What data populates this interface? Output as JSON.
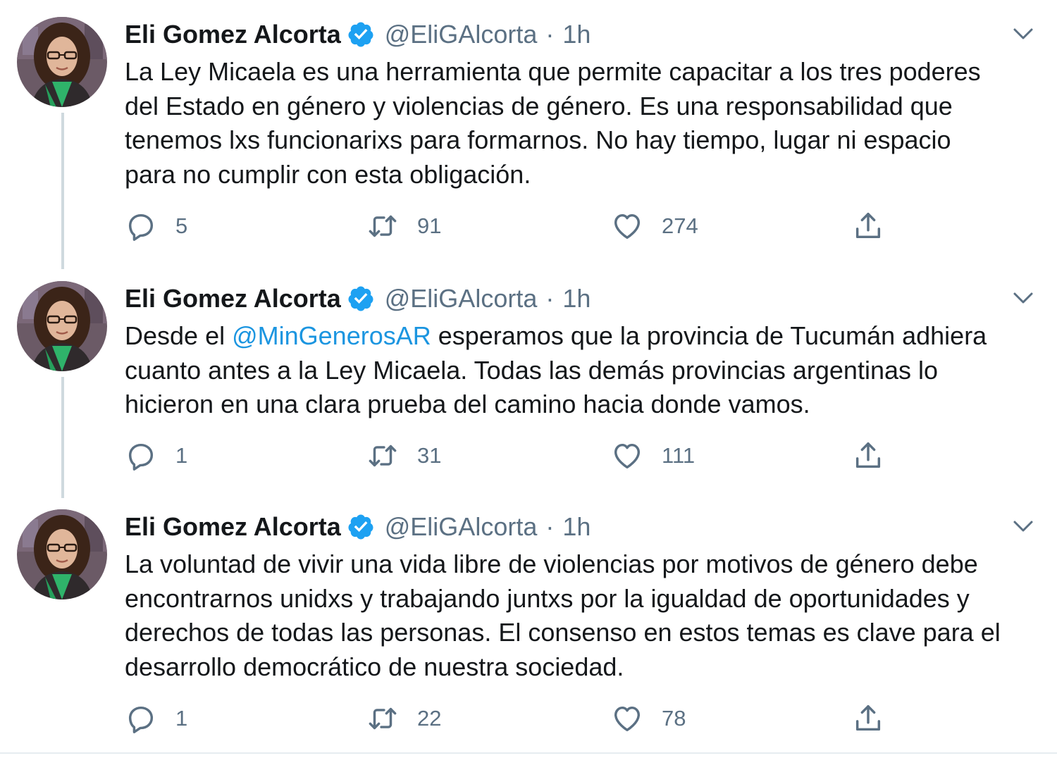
{
  "colors": {
    "text": "#14171a",
    "secondary": "#5b7083",
    "mention": "#1b95e0",
    "verified": "#1da1f2",
    "thread_line": "#cfd9de"
  },
  "tweets": [
    {
      "author_name": "Eli Gomez Alcorta",
      "handle": "@EliGAlcorta",
      "separator": "·",
      "time": "1h",
      "verified_icon": "verified-badge-icon",
      "text_lines": [
        "La Ley Micaela es una herramienta que permite capacitar a los tres poderes",
        "del Estado en género y violencias de género. Es una responsabilidad que",
        "tenemos lxs funcionarixs para formarnos. No hay tiempo, lugar ni espacio",
        "para no cumplir con esta obligación."
      ],
      "replies": "5",
      "retweets": "91",
      "likes": "274"
    },
    {
      "author_name": "Eli Gomez Alcorta",
      "handle": "@EliGAlcorta",
      "separator": "·",
      "time": "1h",
      "verified_icon": "verified-badge-icon",
      "text_line1_before": "Desde el ",
      "text_line1_mention": "@MinGenerosAR",
      "text_line1_after": " esperamos que la provincia de Tucumán adhiera",
      "text_lines": [
        "cuanto antes a la Ley Micaela. Todas las demás provincias argentinas lo",
        "hicieron en una clara prueba del camino hacia donde vamos."
      ],
      "replies": "1",
      "retweets": "31",
      "likes": "111"
    },
    {
      "author_name": "Eli Gomez Alcorta",
      "handle": "@EliGAlcorta",
      "separator": "·",
      "time": "1h",
      "verified_icon": "verified-badge-icon",
      "text_lines": [
        "La voluntad de vivir una vida libre de violencias por motivos de género debe",
        "encontrarnos unidxs y trabajando juntxs por la igualdad de oportunidades y",
        "derechos de todas las personas. El consenso en estos temas es clave para el",
        "desarrollo democrático de nuestra sociedad."
      ],
      "replies": "1",
      "retweets": "22",
      "likes": "78"
    }
  ]
}
